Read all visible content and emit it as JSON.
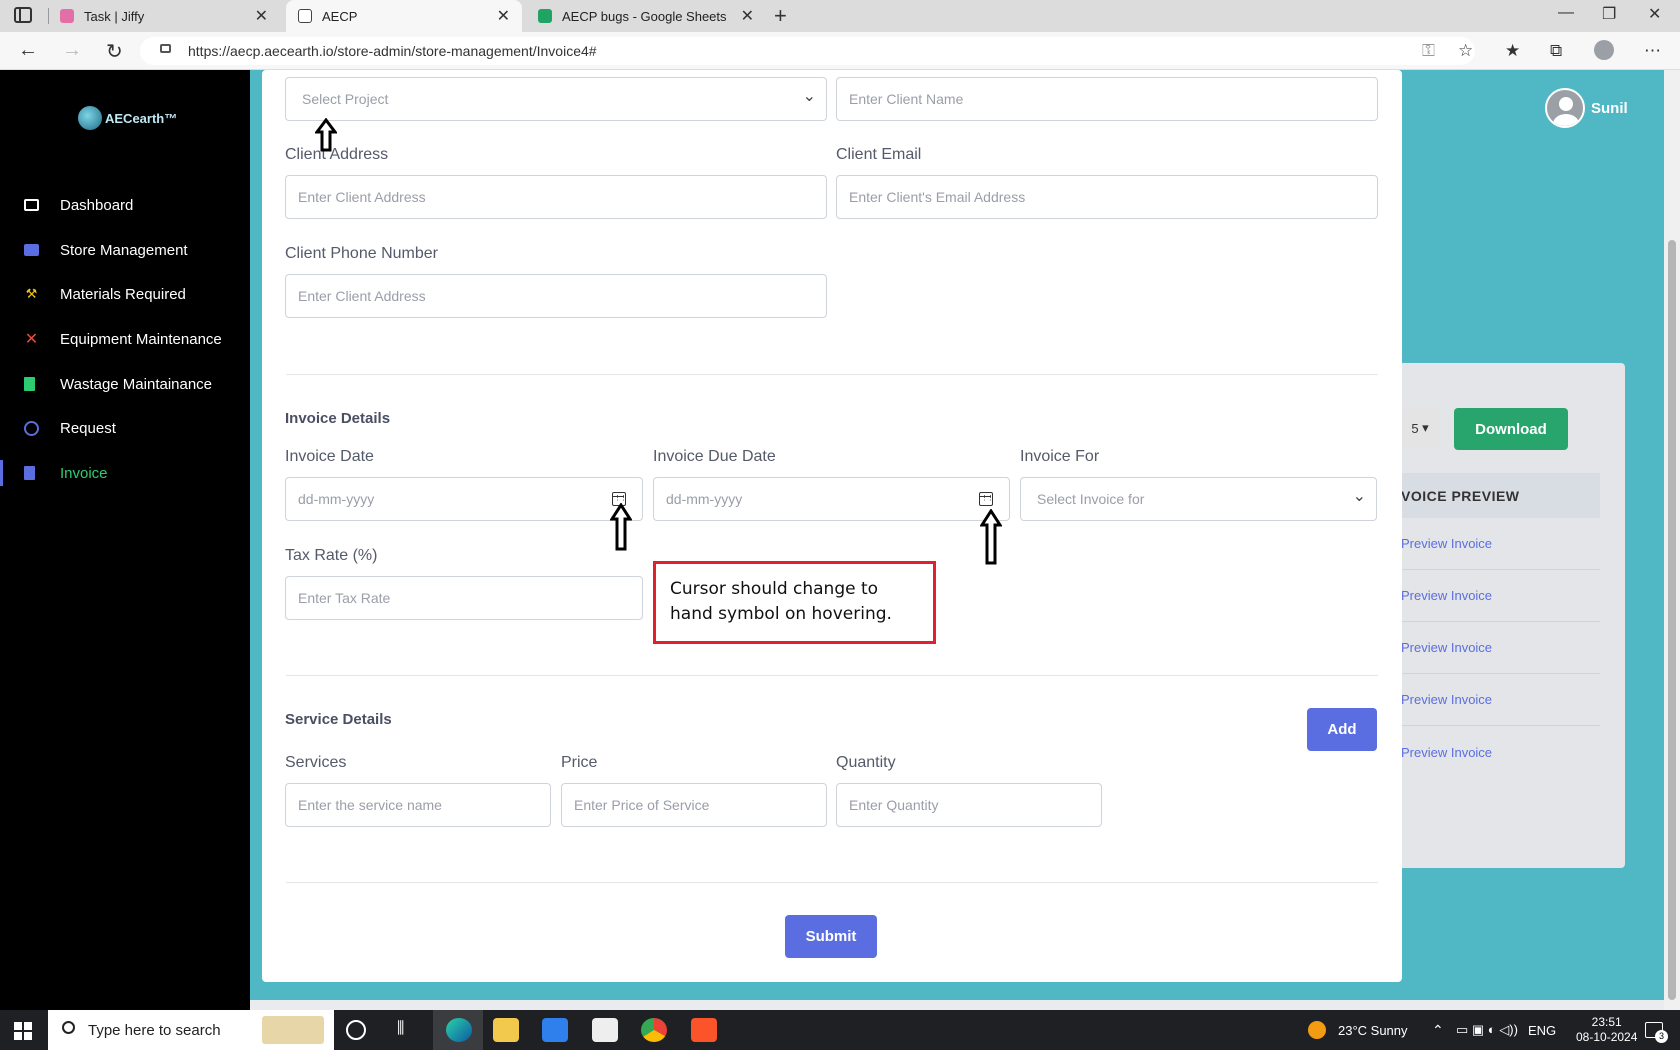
{
  "browser": {
    "tabs": [
      {
        "label": "Task | Jiffy"
      },
      {
        "label": "AECP"
      },
      {
        "label": "AECP bugs - Google Sheets"
      }
    ],
    "url": "https://aecp.aecearth.io/store-admin/store-management/Invoice4#"
  },
  "sidebar": {
    "logo_text": "AECearth™",
    "items": [
      {
        "label": "Dashboard",
        "icon": "monitor-icon",
        "color": "#ffffff"
      },
      {
        "label": "Store Management",
        "icon": "store-icon",
        "color": "#5b6ee1"
      },
      {
        "label": "Materials Required",
        "icon": "hammer-icon",
        "color": "#f1c40f"
      },
      {
        "label": "Equipment Maintenance",
        "icon": "tools-icon",
        "color": "#e74c3c"
      },
      {
        "label": "Wastage Maintainance",
        "icon": "trash-icon",
        "color": "#2ecc71"
      },
      {
        "label": "Request",
        "icon": "request-icon",
        "color": "#5b6ee1"
      },
      {
        "label": "Invoice",
        "icon": "file-icon",
        "color": "#5b6ee1"
      }
    ]
  },
  "user": {
    "name": "Sunil"
  },
  "client": {
    "project_placeholder": "Select Project",
    "name_placeholder": "Enter Client Name",
    "address_label": "Client Address",
    "address_placeholder": "Enter Client Address",
    "email_label": "Client Email",
    "email_placeholder": "Enter Client's Email Address",
    "phone_label": "Client Phone Number",
    "phone_placeholder": "Enter Client Address"
  },
  "invoice": {
    "section_title": "Invoice Details",
    "date_label": "Invoice Date",
    "date_placeholder": "dd-mm-yyyy",
    "due_label": "Invoice Due Date",
    "due_placeholder": "dd-mm-yyyy",
    "for_label": "Invoice For",
    "for_placeholder": "Select Invoice for",
    "tax_label": "Tax Rate (%)",
    "tax_placeholder": "Enter Tax Rate"
  },
  "service": {
    "section_title": "Service Details",
    "add_label": "Add",
    "services_label": "Services",
    "services_placeholder": "Enter the service name",
    "price_label": "Price",
    "price_placeholder": "Enter Price of Service",
    "quantity_label": "Quantity",
    "quantity_placeholder": "Enter Quantity"
  },
  "submit_label": "Submit",
  "annotation": "Cursor should change to hand symbol on hovering.",
  "preview_panel": {
    "page_size": "5",
    "download_label": "Download",
    "header": "VOICE PREVIEW",
    "rows": [
      "Preview Invoice",
      "Preview Invoice",
      "Preview Invoice",
      "Preview Invoice",
      "Preview Invoice"
    ]
  },
  "taskbar": {
    "search_placeholder": "Type here to search",
    "weather": "23°C  Sunny",
    "lang": "ENG",
    "time": "23:51",
    "date": "08-10-2024",
    "notifications": "3"
  }
}
